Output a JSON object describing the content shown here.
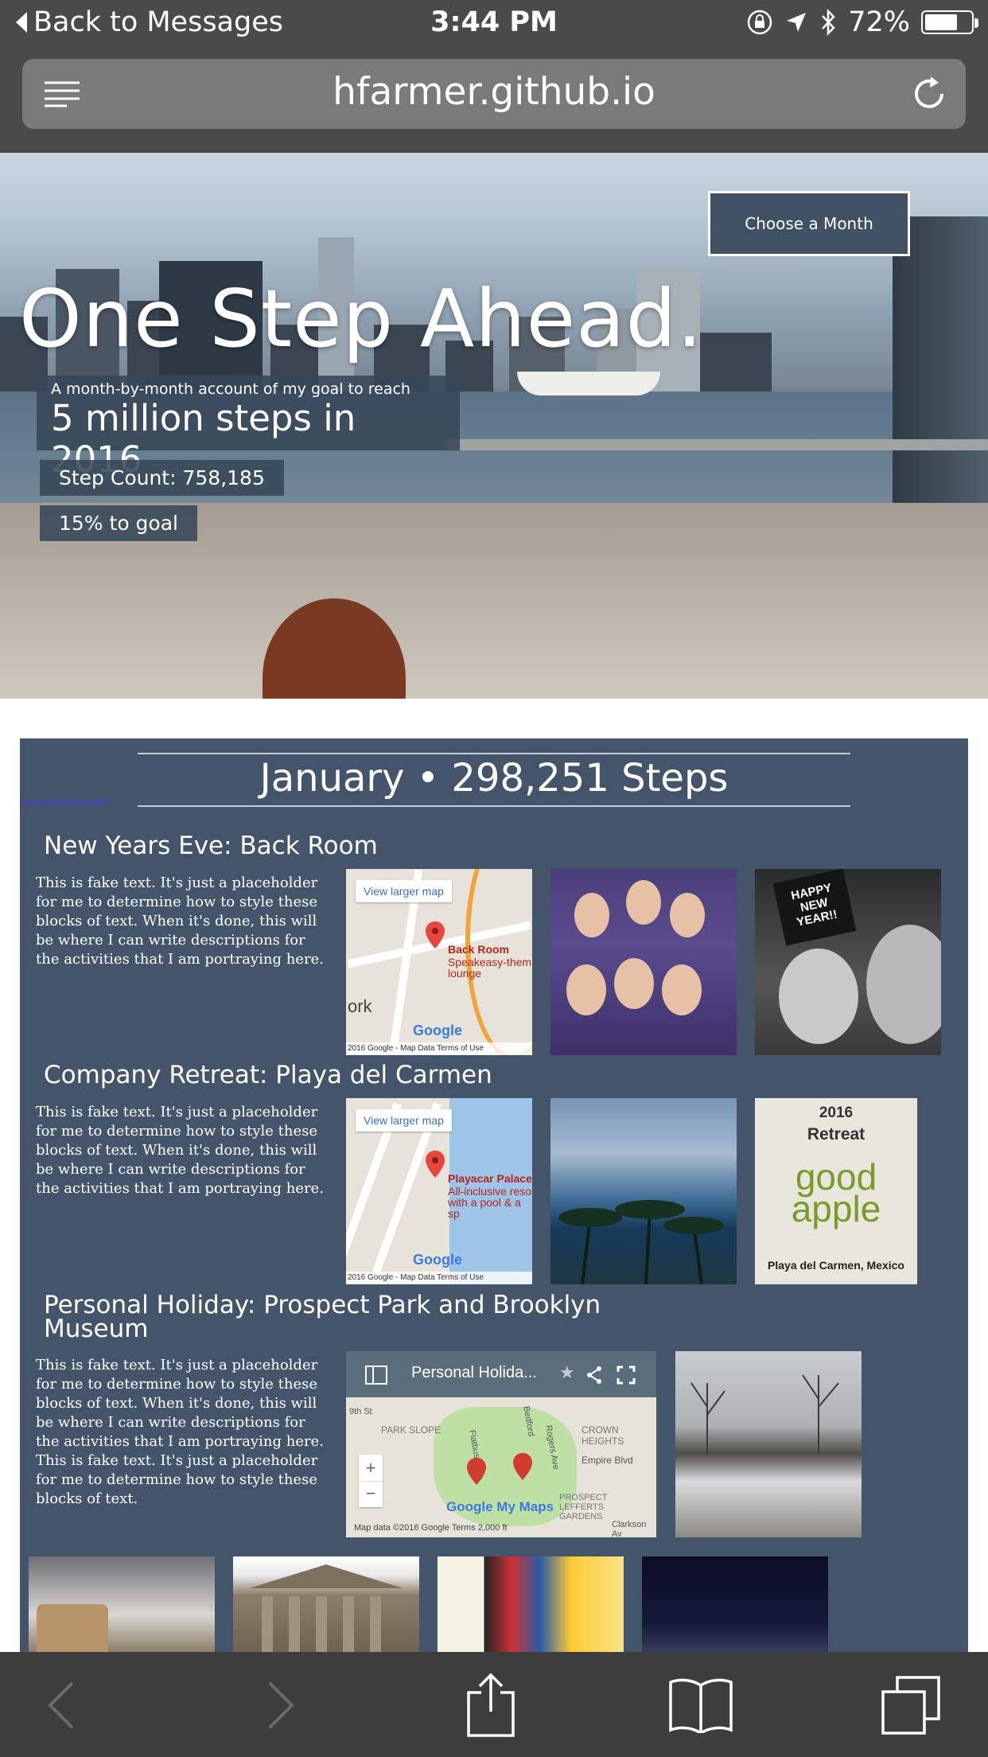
{
  "status": {
    "back_label": "Back to Messages",
    "time": "3:44 PM",
    "battery": "72%",
    "battery_level": 0.72
  },
  "browser": {
    "url": "hfarmer.github.io"
  },
  "hero": {
    "title": "One Step Ahead.",
    "choose_month": "Choose a Month",
    "goal_sub": "A month-by-month account of my goal to reach",
    "goal_big": "5 million steps in 2016",
    "step_count": "Step Count: 758,185",
    "percent": "15% to goal"
  },
  "month": {
    "heading": "January • 298,251 Steps",
    "jump_link": "Jump to #lan on same page",
    "entries": [
      {
        "title": "New Years Eve: Back Room",
        "text": "This is fake text. It's just a placeholder for me to determine how to style these blocks of text. When it's done, this will be where I can write descriptions for the activities that I am portraying here.",
        "map": {
          "view_larger": "View larger map",
          "pin_title": "Back Room",
          "pin_sub": "Speakeasy-them lounge",
          "footer": "2016 Google - Map Data   Terms of Use",
          "logo": "Google",
          "label_ork": "ork"
        },
        "photo_text": "HAPPY NEW YEAR!!"
      },
      {
        "title": "Company Retreat: Playa del Carmen",
        "text": "This is fake text. It's just a placeholder for me to determine how to style these blocks of text. When it's done, this will be where I can write descriptions for the activities that I am portraying here.",
        "map": {
          "view_larger": "View larger map",
          "pin_title": "Playacar Palace",
          "pin_sub": "All-inclusive reso with a pool & a sp",
          "footer": "2016 Google - Map Data   Terms of Use",
          "logo": "Google"
        },
        "card": {
          "year": "2016",
          "retreat": "Retreat",
          "brand_1": "good",
          "brand_2": "apple",
          "place": "Playa del Carmen, Mexico"
        }
      },
      {
        "title": "Personal Holiday: Prospect Park and Brooklyn Museum",
        "text": "This is fake text. It's just a placeholder for me to determine how to style these blocks of text. When it's done, this will be where I can write descriptions for the activities that I am portraying here. This is fake text. It's just a placeholder for me to determine how to style these blocks of text.",
        "mymap": {
          "title": "Personal Holida...",
          "logo": "Google My Maps",
          "footer": "Map data ©2016 Google   Terms   2,000 ft",
          "park_slope": "PARK SLOPE",
          "crown_heights": "CROWN HEIGHTS",
          "empire": "Empire Blvd",
          "lefferts": "PROSPECT LEFFERTS GARDENS",
          "clarkson": "Clarkson Av",
          "flatbush": "Flatbush Ave",
          "bedford": "Bedford",
          "rogers": "Rogers Ave",
          "ninth": "9th St"
        }
      }
    ]
  },
  "colors": {
    "chrome": "#4a4a4a",
    "panel": "#44546a",
    "toolbar": "#3d3d3d"
  }
}
